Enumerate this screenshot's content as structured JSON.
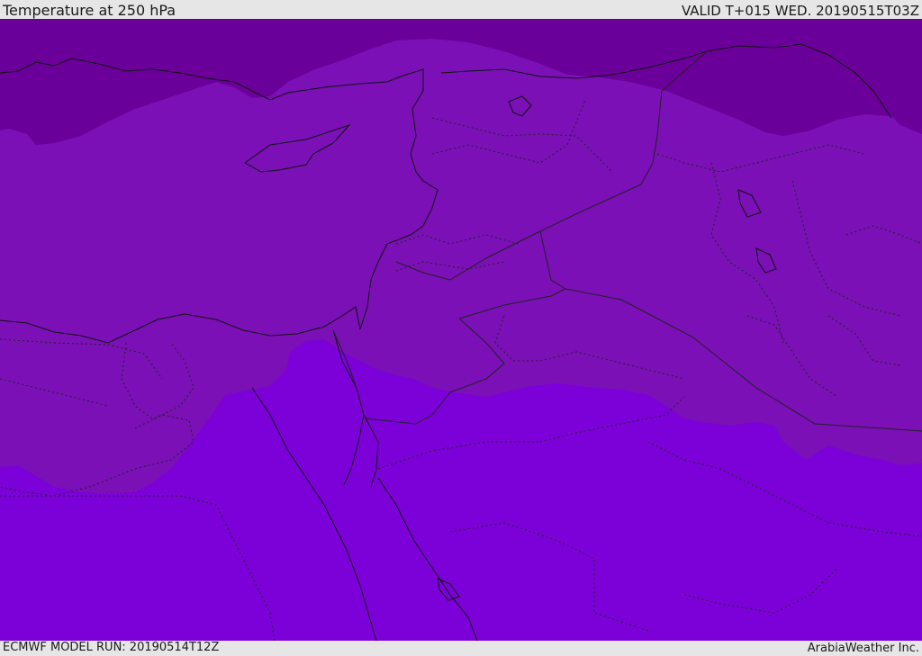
{
  "header": {
    "title": "Temperature at 250 hPa",
    "valid_time": "VALID T+015 WED. 20190515T03Z"
  },
  "footer": {
    "model_run": "ECMWF MODEL RUN: 20190514T12Z",
    "brand": "ArabiaWeather Inc."
  },
  "map": {
    "colors": {
      "band_cold": "#6a0099",
      "band_mid": "#7a10b6",
      "band_warm": "#7c00d8",
      "coastline": "#111111",
      "border": "#222222"
    }
  }
}
